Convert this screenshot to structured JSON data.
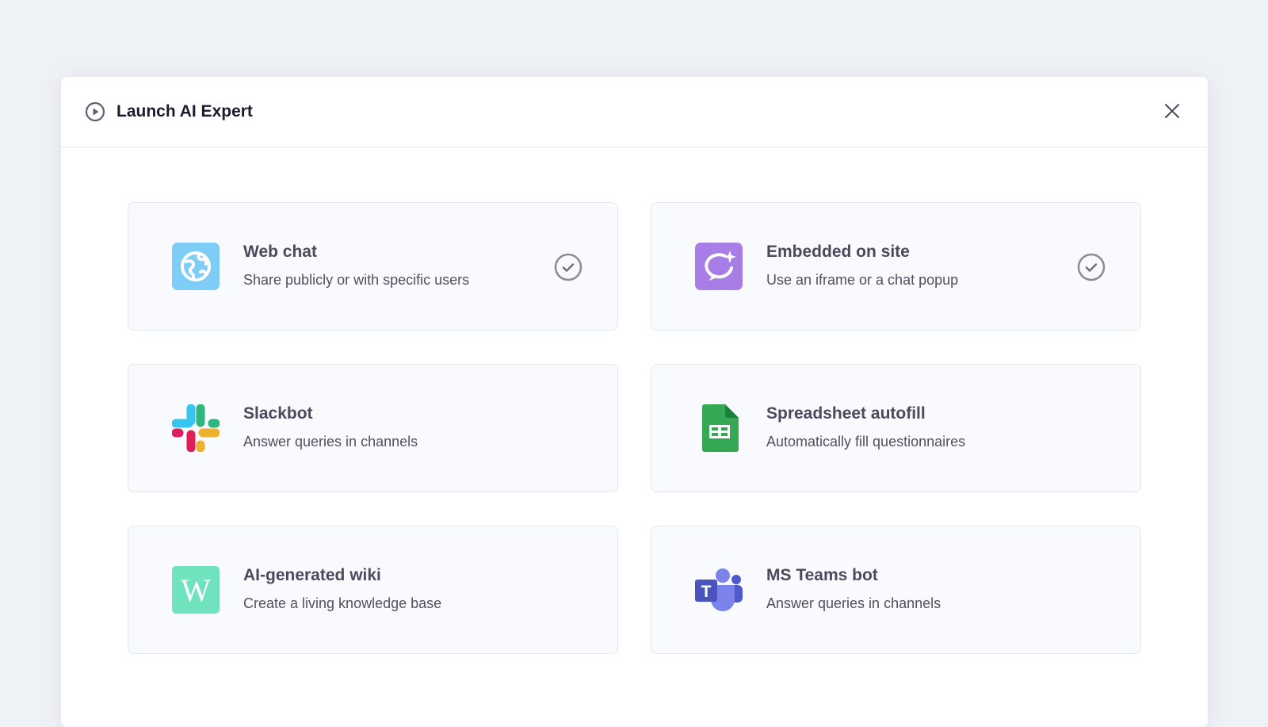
{
  "modal": {
    "title": "Launch AI Expert"
  },
  "options": [
    {
      "name": "Web chat",
      "description": "Share publicly or with specific users",
      "icon": "globe-icon",
      "selected": true,
      "color": "#7dcdf7"
    },
    {
      "name": "Embedded on site",
      "description": "Use an iframe or a chat popup",
      "icon": "chat-sparkle-icon",
      "selected": true,
      "color": "#a87de6"
    },
    {
      "name": "Slackbot",
      "description": "Answer queries in channels",
      "icon": "slack-icon",
      "selected": false
    },
    {
      "name": "Spreadsheet autofill",
      "description": "Automatically fill questionnaires",
      "icon": "google-sheets-icon",
      "selected": false,
      "color": "#34a853"
    },
    {
      "name": "AI-generated wiki",
      "description": "Create a living knowledge base",
      "icon": "wiki-icon",
      "selected": false,
      "color": "#6ee3bd",
      "icon_letter": "W"
    },
    {
      "name": "MS Teams bot",
      "description": "Answer queries in channels",
      "icon": "ms-teams-icon",
      "selected": false,
      "color": "#5059c9",
      "icon_letter": "T"
    }
  ]
}
